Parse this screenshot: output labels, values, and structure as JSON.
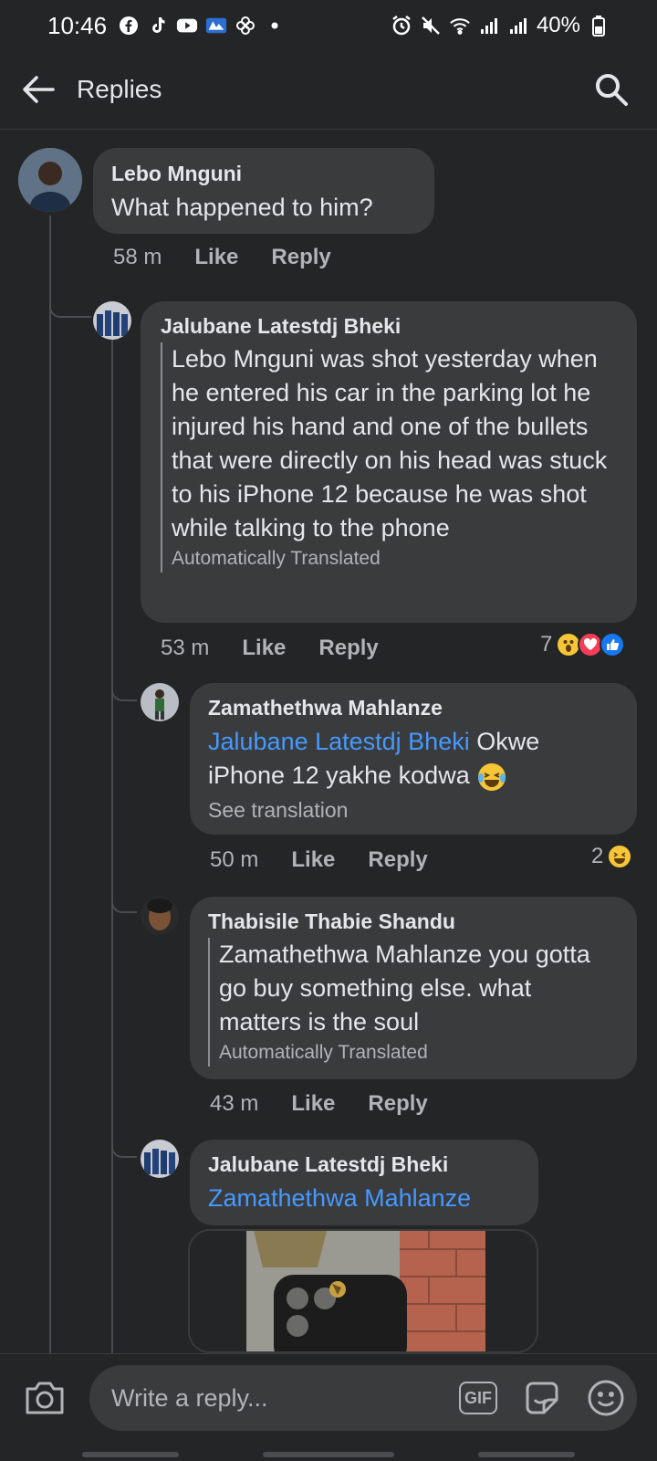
{
  "status_bar": {
    "time": "10:46",
    "battery": "40%"
  },
  "header": {
    "title": "Replies"
  },
  "comments": [
    {
      "author": "Lebo Mnguni",
      "text": "What happened to him?",
      "time": "58 m",
      "like": "Like",
      "reply": "Reply"
    },
    {
      "author": "Jalubane Latestdj Bheki",
      "text": "Lebo Mnguni was shot yesterday when he entered his car in the parking lot he injured his hand and one of the bullets that were directly on his head was stuck to his iPhone 12 because he was shot while talking to the phone",
      "translation_note": "Automatically Translated",
      "time": "53 m",
      "like": "Like",
      "reply": "Reply",
      "reaction_count": "7"
    },
    {
      "author": "Zamathethwa Mahlanze",
      "mention": "Jalubane Latestdj Bheki",
      "text": " Okwe iPhone 12 yakhe kodwa",
      "see_translation": "See translation",
      "time": "50 m",
      "like": "Like",
      "reply": "Reply",
      "reaction_count": "2"
    },
    {
      "author": "Thabisile Thabie Shandu",
      "text": "Zamathethwa Mahlanze you gotta go buy something else. what matters is the soul",
      "translation_note": "Automatically Translated",
      "time": "43 m",
      "like": "Like",
      "reply": "Reply"
    },
    {
      "author": "Jalubane Latestdj Bheki",
      "mention": "Zamathethwa Mahlanze"
    }
  ],
  "composer": {
    "placeholder": "Write a reply...",
    "gif_label": "GIF"
  },
  "colors": {
    "background": "#242526",
    "bubble": "#3a3b3c",
    "mention": "#4599ff",
    "secondary_text": "#b0b3b8"
  }
}
